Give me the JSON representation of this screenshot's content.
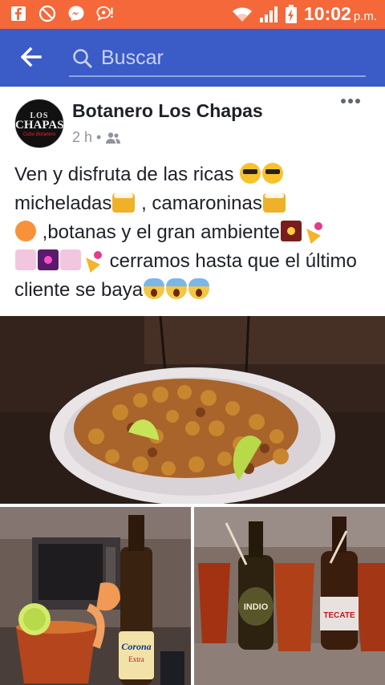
{
  "status_bar": {
    "time": "10:02",
    "ampm": "p.m.",
    "background": "#f4683a",
    "left_icons": [
      "facebook-icon",
      "blocked-icon",
      "messenger-icon",
      "chat-alert-icon"
    ],
    "right_icons": [
      "wifi-icon",
      "signal-icon",
      "battery-charging-icon"
    ]
  },
  "top_bar": {
    "background": "#3b5bc6",
    "search_placeholder": "Buscar",
    "back_icon": "arrow-left-icon",
    "search_icon": "search-icon"
  },
  "post": {
    "page_name": "Botanero Los Chapas",
    "time_ago": "2 h",
    "separator": "•",
    "audience_icon": "friends-icon",
    "avatar": {
      "line1": "LOS",
      "line2": "CHAPAS",
      "line3": "Cubo Botanero"
    },
    "text": {
      "p1": "Ven y disfruta de las ricas ",
      "p2": "micheladas",
      "p3": " , camaroninas",
      "p4": " ,botanas y el gran ambiente",
      "p5": " cerramos hasta que el último cliente se baya"
    },
    "emojis": {
      "cool": "smiling-face-with-sunglasses",
      "beers": "clinking-beer-mugs",
      "shrimp": "fried-shrimp",
      "fireworks": "fireworks",
      "party": "party-popper",
      "confetti": "confetti",
      "sparkler": "sparkler",
      "scream": "face-screaming-in-fear"
    },
    "photos": {
      "main": "plate-of-botanas-photo",
      "left": "michelada-with-corona-photo",
      "right": "micheladas-with-beers-photo",
      "label_corona_line1": "Corona",
      "label_corona_line2": "Extra",
      "label_indio": "INDIO",
      "label_tecate": "TECATE"
    }
  }
}
